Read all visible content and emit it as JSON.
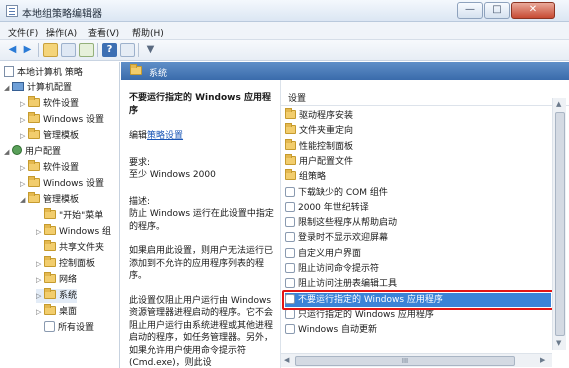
{
  "window": {
    "title": "本地组策略编辑器",
    "minimize": "—",
    "maximize": "□",
    "close": "✕"
  },
  "menu": [
    "文件(F)",
    "操作(A)",
    "查看(V)",
    "帮助(H)"
  ],
  "tree": {
    "root": "本地计算机 策略",
    "computer_config": "计算机配置",
    "software_settings_1": "软件设置",
    "windows_settings_1": "Windows 设置",
    "admin_templates_1": "管理模板",
    "user_config": "用户配置",
    "software_settings_2": "软件设置",
    "windows_settings_2": "Windows 设置",
    "admin_templates_2": "管理模板",
    "start_menu": "\"开始\"菜单",
    "windows_components": "Windows 组",
    "shared_folders": "共享文件夹",
    "control_panel": "控制面板",
    "network": "网络",
    "system": "系统",
    "desktop": "桌面",
    "all_settings": "所有设置"
  },
  "right_header": "系统",
  "description": {
    "title": "不要运行指定的 Windows 应用程序",
    "edit_prefix": "编辑",
    "edit_link": "策略设置",
    "requirement": "要求:",
    "requirement_value": "至少 Windows 2000",
    "desc_label": "描述:",
    "desc_text": "防止 Windows 运行在此设置中指定的程序。",
    "enabled_text": "如果启用此设置，则用户无法运行已添加到不允许的应用程序列表的程序。",
    "detail_text": "此设置仅阻止用户运行由 Windows 资源管理器进程启动的程序。它不会阻止用户运行由系统进程或其他进程启动的程序，如任务管理器。另外，如果允许用户使用命令提示符(Cmd.exe)，则此设"
  },
  "list": {
    "header": "设置",
    "rows": [
      "驱动程序安装",
      "文件夹重定向",
      "性能控制面板",
      "用户配置文件",
      "组策略",
      "下载缺少的 COM 组件",
      "2000 年世纪转译",
      "限制这些程序从帮助启动",
      "登录时不显示欢迎屏幕",
      "自定义用户界面",
      "阻止访问命令提示符",
      "阻止访问注册表编辑工具",
      "不要运行指定的 Windows 应用程序",
      "只运行指定的 Windows 应用程序",
      "Windows 自动更新"
    ],
    "selected_index": 12
  },
  "scroll": {
    "thumb_grip": "III"
  },
  "colors": {
    "selection": "#3b83d7",
    "highlight_border": "#e31414",
    "header": "#3a6bab"
  }
}
